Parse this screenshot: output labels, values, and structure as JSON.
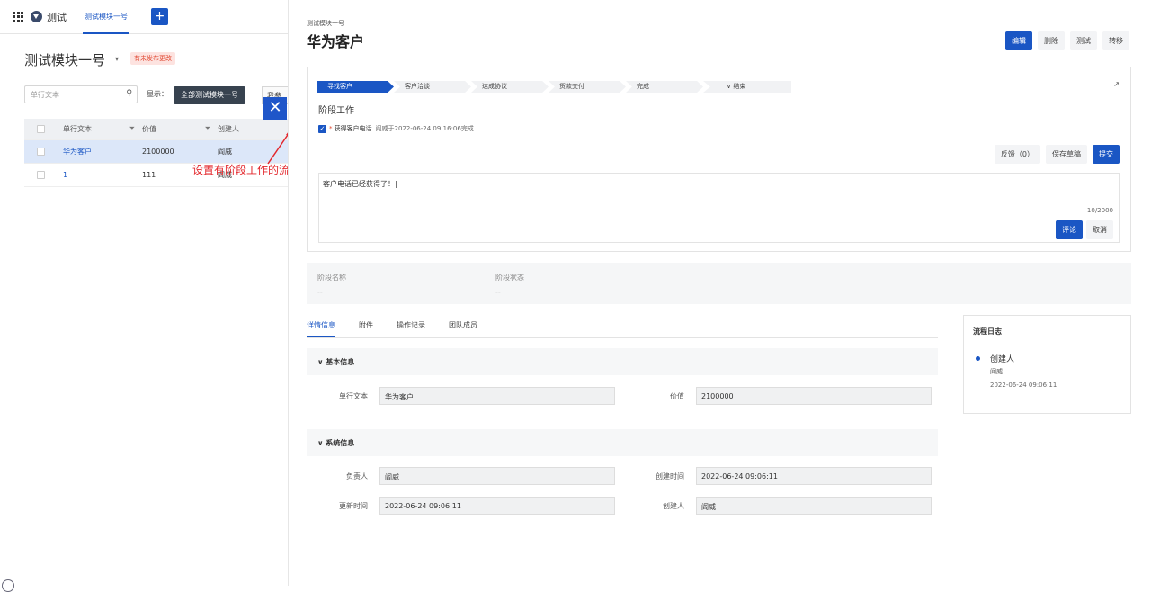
{
  "topbar": {
    "app_name": "测试",
    "tab": "测试模块一号",
    "plus": "+"
  },
  "module": {
    "title": "测试模块一号",
    "caret": "▾",
    "badge": "有未发布更改"
  },
  "search": {
    "placeholder": "单行文本",
    "icon": "search-icon"
  },
  "filter_bar": {
    "show_label": "显示：",
    "show_value": "全部测试模块一号",
    "extra": "我参与"
  },
  "table": {
    "headers": [
      "单行文本",
      "价值",
      "创建人"
    ],
    "rows": [
      {
        "text": "华为客户",
        "value": "2100000",
        "creator": "阎威"
      },
      {
        "text": "1",
        "value": "111",
        "creator": "阎威"
      }
    ]
  },
  "annotation": "设置有阶段工作的流程出现了阶段工作内容",
  "record": {
    "breadcrumb": "测试模块一号",
    "title": "华为客户",
    "actions": [
      "编辑",
      "删除",
      "测试",
      "转移"
    ]
  },
  "stages": [
    "寻找客户",
    "客户洽谈",
    "达成协议",
    "货款交付",
    "完成",
    "∨ 结束"
  ],
  "stage_work": {
    "title": "阶段工作",
    "task_required": "*",
    "task_name": "获得客户电话",
    "task_done": "阎威于2022-06-24 09:16:06完成",
    "feedback": "反馈（0）",
    "save_draft": "保存草稿",
    "submit": "提交",
    "comment_text": "客户电话已经获得了！|",
    "counter": "10/2000",
    "comment_btn": "评论",
    "cancel_btn": "取消"
  },
  "stage_info": {
    "name_label": "阶段名称",
    "name_value": "--",
    "status_label": "阶段状态",
    "status_value": "--"
  },
  "tabs": [
    "详情信息",
    "附件",
    "操作记录",
    "团队成员"
  ],
  "basic": {
    "title": "∨  基本信息",
    "text_label": "单行文本",
    "text_value": "华为客户",
    "value_label": "价值",
    "value_value": "2100000"
  },
  "system": {
    "title": "∨  系统信息",
    "owner_label": "负责人",
    "owner_value": "阎威",
    "created_label": "创建时间",
    "created_value": "2022-06-24 09:06:11",
    "updated_label": "更新时间",
    "updated_value": "2022-06-24 09:06:11",
    "creator_label": "创建人",
    "creator_value": "阎威"
  },
  "log": {
    "title": "流程日志",
    "event": "创建人",
    "user": "阎威",
    "time": "2022-06-24 09:06:11"
  },
  "colors": {
    "primary": "#1a56c4",
    "annotation": "#e3262b",
    "badge_bg": "#fde3e0"
  }
}
